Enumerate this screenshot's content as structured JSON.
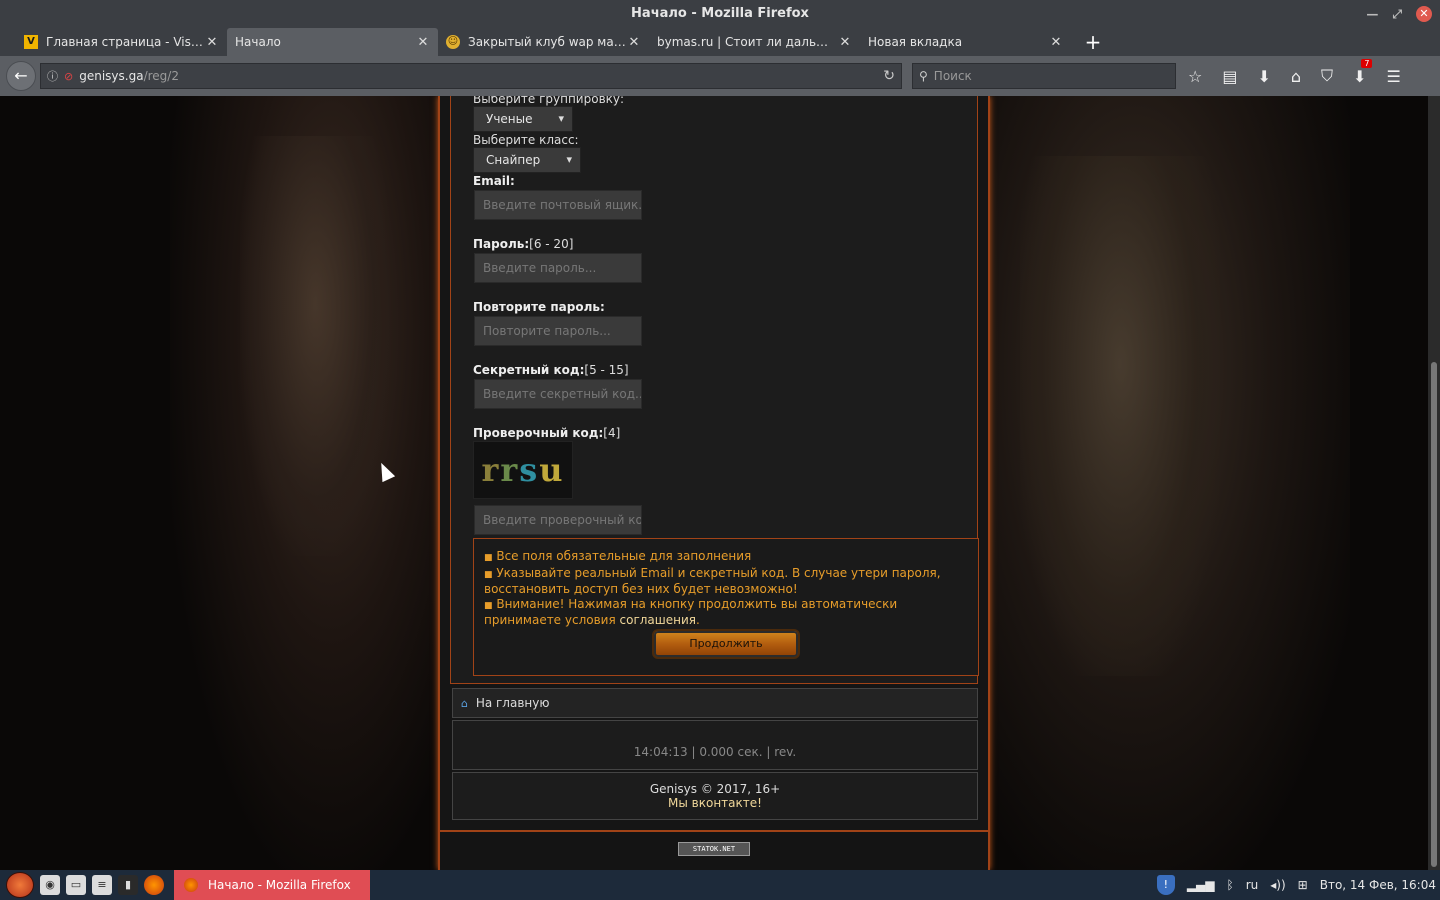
{
  "window": {
    "title": "Начало - Mozilla Firefox"
  },
  "tabs": [
    {
      "label": "Главная страница - Visa...",
      "favicon": "V"
    },
    {
      "label": "Начало",
      "favicon": ""
    },
    {
      "label": "Закрытый клуб wap мас...",
      "favicon": "☺"
    },
    {
      "label": "bymas.ru | Стоит ли дальш...",
      "favicon": ""
    },
    {
      "label": "Новая вкладка",
      "favicon": ""
    }
  ],
  "navbar": {
    "url_host": "genisys.ga",
    "url_path": "/reg/2",
    "search_placeholder": "Поиск",
    "downloads_badge": "7"
  },
  "form": {
    "group_label": "Выберите группировку:",
    "group_value": "Ученые",
    "class_label": "Выберите класс:",
    "class_value": "Снайпер",
    "email_label": "Email:",
    "email_placeholder": "Введите почтовый ящик...",
    "password_label": "Пароль:",
    "password_hint": "[6 - 20]",
    "password_placeholder": "Введите пароль...",
    "repeat_label": "Повторите пароль:",
    "repeat_placeholder": "Повторите пароль...",
    "secret_label": "Секретный код:",
    "secret_hint": "[5 - 15]",
    "secret_placeholder": "Введите секретный код...",
    "captcha_label": "Проверочный код:",
    "captcha_hint": "[4]",
    "captcha_chars": [
      "r",
      "r",
      "s",
      "u"
    ],
    "captcha_placeholder": "Введите проверочный код..."
  },
  "notice": {
    "line1": "Все поля обязательные для заполнения",
    "line2": "Указывайте реальный Email и секретный код. В случае утери пароля, восстановить доступ без них будет невозможно!",
    "line3_prefix": "Внимание! Нажимая на кнопку продолжить вы автоматически принимаете условия",
    "line3_link": "соглашения",
    "button": "Продолжить"
  },
  "home_link": "На главную",
  "stats": "14:04:13 | 0.000 сек. | rev.",
  "footer": {
    "copyright": "Genisys © 2017, 16+",
    "vk": "Мы вконтакте!"
  },
  "counter": "STATOK.NET",
  "taskbar": {
    "task_label": "Начало - Mozilla Firefox",
    "lang": "ru",
    "clock": "Вто, 14 Фев, 16:04"
  },
  "colors": {
    "accent": "#a14317",
    "notice_text": "#e79d2a",
    "task_active": "#e04d54"
  }
}
